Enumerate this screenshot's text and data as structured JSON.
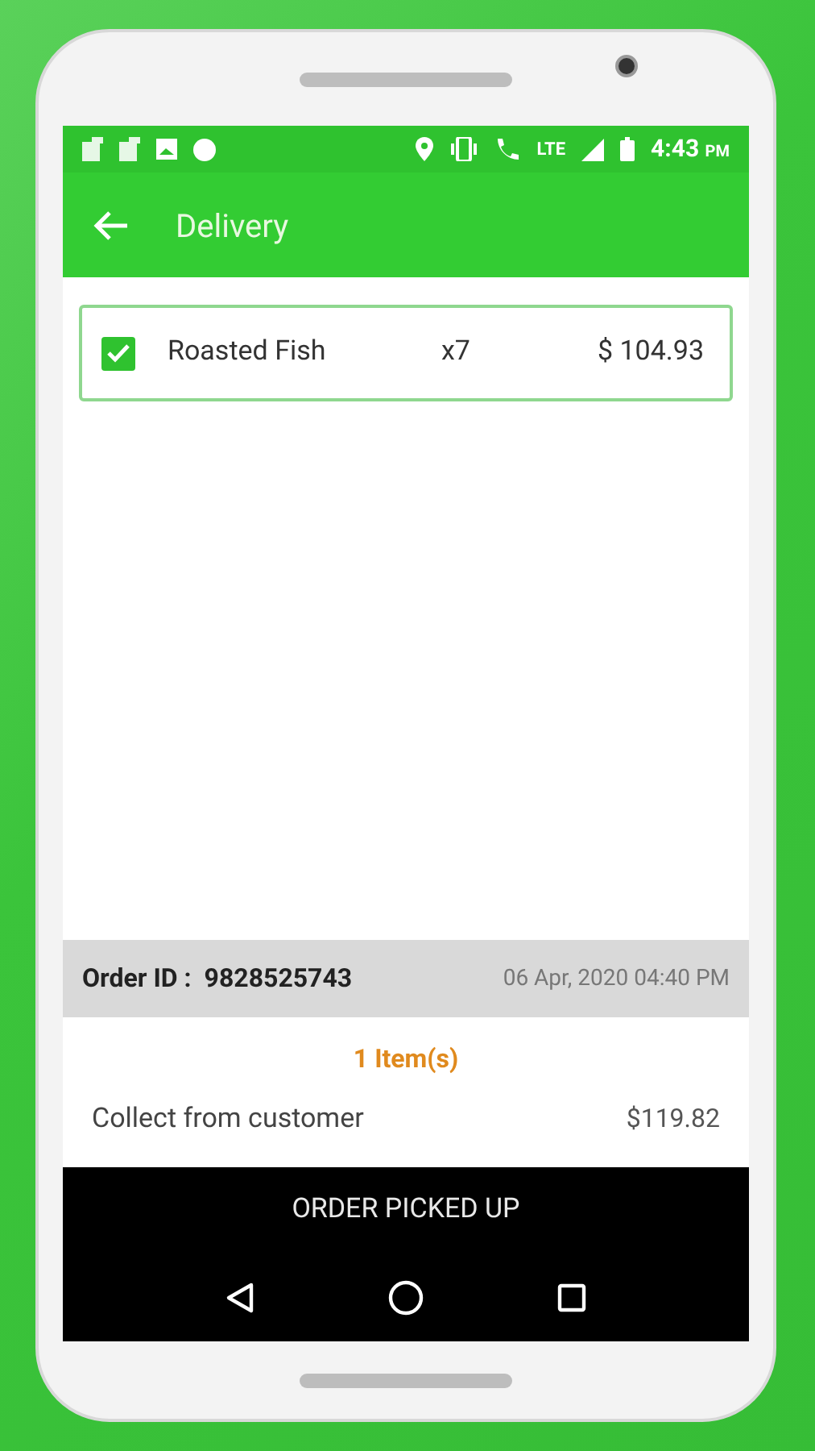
{
  "status_bar": {
    "time": "4:43",
    "ampm": "PM",
    "network": "LTE"
  },
  "toolbar": {
    "title": "Delivery"
  },
  "items": [
    {
      "name": "Roasted Fish",
      "quantity": "x7",
      "price": "$ 104.93",
      "checked": true
    }
  ],
  "order": {
    "label": "Order ID :",
    "id": "9828525743",
    "date": "06 Apr, 2020 04:40 PM"
  },
  "item_count": "1 Item(s)",
  "collect": {
    "label": "Collect from customer",
    "amount": "$119.82"
  },
  "action_button": "ORDER PICKED UP"
}
